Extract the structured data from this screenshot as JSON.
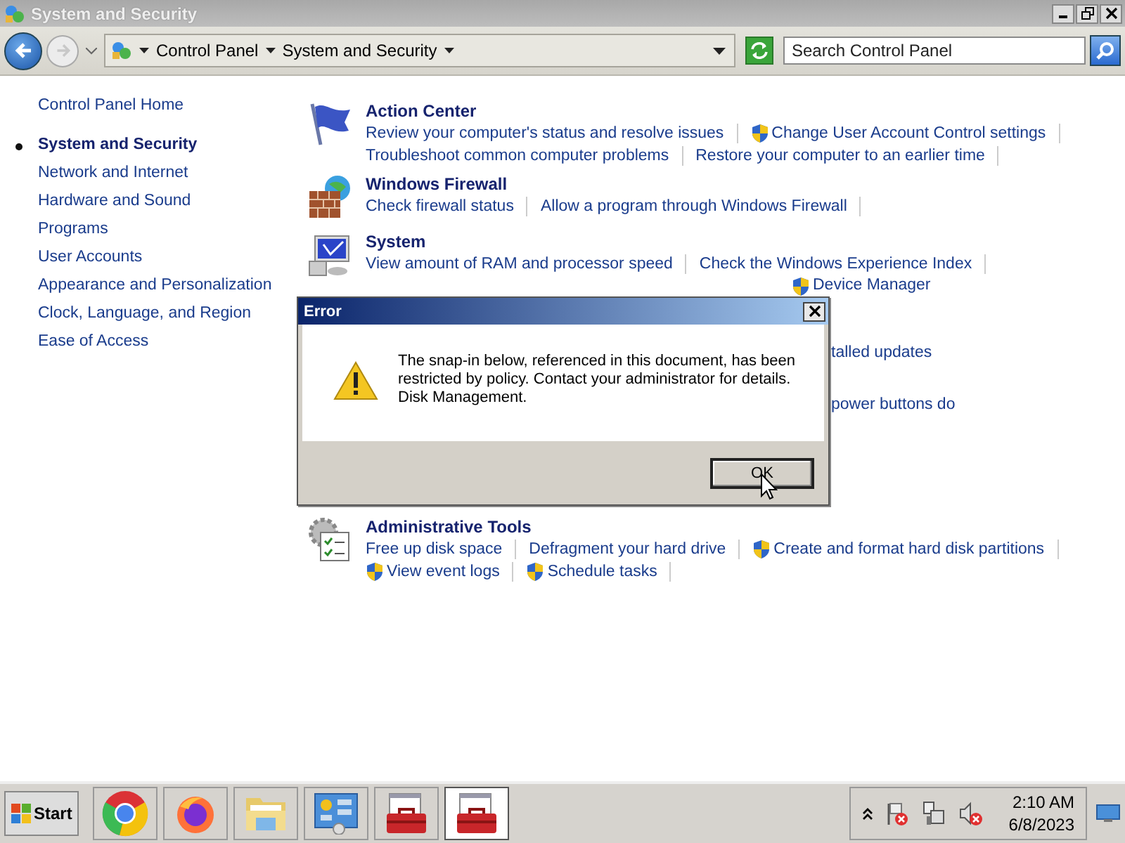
{
  "window": {
    "title": "System and Security"
  },
  "address": {
    "crumbs": [
      "Control Panel",
      "System and Security"
    ]
  },
  "search": {
    "placeholder": "Search Control Panel"
  },
  "sidebar": {
    "home": "Control Panel Home",
    "items": [
      {
        "label": "System and Security",
        "selected": true
      },
      {
        "label": "Network and Internet",
        "selected": false
      },
      {
        "label": "Hardware and Sound",
        "selected": false
      },
      {
        "label": "Programs",
        "selected": false
      },
      {
        "label": "User Accounts",
        "selected": false
      },
      {
        "label": "Appearance and Personalization",
        "selected": false
      },
      {
        "label": "Clock, Language, and Region",
        "selected": false
      },
      {
        "label": "Ease of Access",
        "selected": false
      }
    ]
  },
  "sections": [
    {
      "kind": "flag",
      "title": "Action Center",
      "rows": [
        [
          {
            "text": "Review your computer's status and resolve issues",
            "shield": false
          },
          {
            "text": "Change User Account Control settings",
            "shield": true
          }
        ],
        [
          {
            "text": "Troubleshoot common computer problems",
            "shield": false
          },
          {
            "text": "Restore your computer to an earlier time",
            "shield": false
          }
        ]
      ]
    },
    {
      "kind": "firewall",
      "title": "Windows Firewall",
      "rows": [
        [
          {
            "text": "Check firewall status",
            "shield": false
          },
          {
            "text": "Allow a program through Windows Firewall",
            "shield": false
          }
        ]
      ]
    },
    {
      "kind": "system",
      "title": "System",
      "rows": [
        [
          {
            "text": "View amount of RAM and processor speed",
            "shield": false
          },
          {
            "text": "Check the Windows Experience Index",
            "shield": false
          }
        ]
      ]
    }
  ],
  "partial_links": [
    {
      "text": "Device Manager",
      "shield": true
    },
    {
      "text": "talled updates",
      "shield": false
    },
    {
      "text": "power buttons do",
      "shield": false
    }
  ],
  "admin": {
    "kind": "tools",
    "title": "Administrative Tools",
    "rows": [
      [
        {
          "text": "Free up disk space",
          "shield": false
        },
        {
          "text": "Defragment your hard drive",
          "shield": false
        },
        {
          "text": "Create and format hard disk partitions",
          "shield": true
        }
      ],
      [
        {
          "text": "View event logs",
          "shield": true
        },
        {
          "text": "Schedule tasks",
          "shield": true
        }
      ]
    ]
  },
  "dialog": {
    "title": "Error",
    "message": "The snap-in below, referenced in this document, has been restricted by policy. Contact your administrator for details.",
    "detail": "Disk Management.",
    "button": "OK"
  },
  "taskbar": {
    "start": "Start",
    "apps": [
      {
        "kind": "chrome",
        "selected": false
      },
      {
        "kind": "firefox",
        "selected": false
      },
      {
        "kind": "explorer",
        "selected": false
      },
      {
        "kind": "control",
        "selected": false
      },
      {
        "kind": "toolbox",
        "selected": false
      },
      {
        "kind": "toolbox",
        "selected": true
      }
    ],
    "time": "2:10 AM",
    "date": "6/8/2023"
  }
}
